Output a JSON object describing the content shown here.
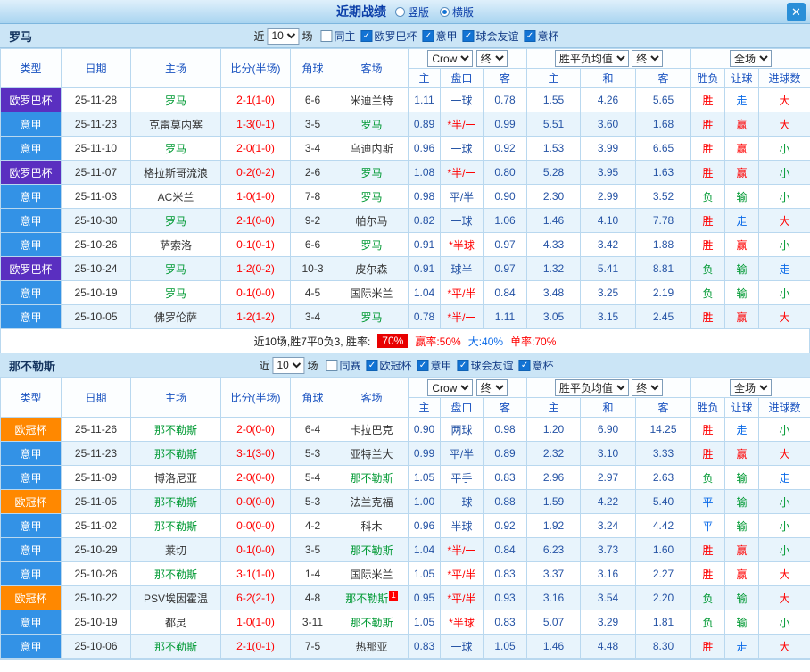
{
  "titlebar": {
    "title": "近期战绩",
    "layout_options": [
      {
        "label": "竖版",
        "selected": false
      },
      {
        "label": "横版",
        "selected": true
      }
    ],
    "close_icon": "✕"
  },
  "league_colors": {
    "意甲": "#3392e6",
    "欧罗巴杯": "#5a2fc0",
    "欧冠杯": "#ff8800"
  },
  "table_header": {
    "main": [
      "类型",
      "日期",
      "主场",
      "比分(半场)",
      "角球",
      "客场"
    ],
    "odds_select": "Crow",
    "odds_final": "终",
    "avg_select": "胜平负均值",
    "avg_final": "终",
    "full_select": "全场",
    "odds_sub": [
      "主",
      "盘口",
      "客"
    ],
    "avg_sub": [
      "主",
      "和",
      "客"
    ],
    "full_sub": [
      "胜负",
      "让球",
      "进球数"
    ]
  },
  "sections": [
    {
      "team": "罗马",
      "filter": {
        "near_label": "近",
        "count": "10",
        "games_label": "场",
        "checkboxes": [
          {
            "label": "同主",
            "checked": false
          },
          {
            "label": "欧罗巴杯",
            "checked": true
          },
          {
            "label": "意甲",
            "checked": true
          },
          {
            "label": "球会友谊",
            "checked": true
          },
          {
            "label": "意杯",
            "checked": true
          }
        ]
      },
      "rows": [
        {
          "league": "欧罗巴杯",
          "date": "25-11-28",
          "home": "罗马",
          "home_focus": true,
          "score": "2-1(1-0)",
          "corners": "6-6",
          "away": "米迪兰特",
          "away_focus": false,
          "away_badge": "",
          "odds": [
            "1.11",
            "一球",
            "0.78"
          ],
          "handicap_red": false,
          "avg": [
            "1.55",
            "4.26",
            "5.65"
          ],
          "result": {
            "text": "胜",
            "color": "red"
          },
          "asian": {
            "text": "走",
            "color": "blue"
          },
          "goals": {
            "text": "大",
            "color": "red"
          }
        },
        {
          "league": "意甲",
          "date": "25-11-23",
          "home": "克雷莫内塞",
          "home_focus": false,
          "score": "1-3(0-1)",
          "corners": "3-5",
          "away": "罗马",
          "away_focus": true,
          "away_badge": "",
          "odds": [
            "0.89",
            "*半/一",
            "0.99"
          ],
          "handicap_red": true,
          "avg": [
            "5.51",
            "3.60",
            "1.68"
          ],
          "result": {
            "text": "胜",
            "color": "red"
          },
          "asian": {
            "text": "赢",
            "color": "red"
          },
          "goals": {
            "text": "大",
            "color": "red"
          }
        },
        {
          "league": "意甲",
          "date": "25-11-10",
          "home": "罗马",
          "home_focus": true,
          "score": "2-0(1-0)",
          "corners": "3-4",
          "away": "乌迪内斯",
          "away_focus": false,
          "away_badge": "",
          "odds": [
            "0.96",
            "一球",
            "0.92"
          ],
          "handicap_red": false,
          "avg": [
            "1.53",
            "3.99",
            "6.65"
          ],
          "result": {
            "text": "胜",
            "color": "red"
          },
          "asian": {
            "text": "赢",
            "color": "red"
          },
          "goals": {
            "text": "小",
            "color": "green"
          }
        },
        {
          "league": "欧罗巴杯",
          "date": "25-11-07",
          "home": "格拉斯哥流浪",
          "home_focus": false,
          "score": "0-2(0-2)",
          "corners": "2-6",
          "away": "罗马",
          "away_focus": true,
          "away_badge": "",
          "odds": [
            "1.08",
            "*半/一",
            "0.80"
          ],
          "handicap_red": true,
          "avg": [
            "5.28",
            "3.95",
            "1.63"
          ],
          "result": {
            "text": "胜",
            "color": "red"
          },
          "asian": {
            "text": "赢",
            "color": "red"
          },
          "goals": {
            "text": "小",
            "color": "green"
          }
        },
        {
          "league": "意甲",
          "date": "25-11-03",
          "home": "AC米兰",
          "home_focus": false,
          "score": "1-0(1-0)",
          "corners": "7-8",
          "away": "罗马",
          "away_focus": true,
          "away_badge": "",
          "odds": [
            "0.98",
            "平/半",
            "0.90"
          ],
          "handicap_red": false,
          "avg": [
            "2.30",
            "2.99",
            "3.52"
          ],
          "result": {
            "text": "负",
            "color": "green"
          },
          "asian": {
            "text": "输",
            "color": "green"
          },
          "goals": {
            "text": "小",
            "color": "green"
          }
        },
        {
          "league": "意甲",
          "date": "25-10-30",
          "home": "罗马",
          "home_focus": true,
          "score": "2-1(0-0)",
          "corners": "9-2",
          "away": "帕尔马",
          "away_focus": false,
          "away_badge": "",
          "odds": [
            "0.82",
            "一球",
            "1.06"
          ],
          "handicap_red": false,
          "avg": [
            "1.46",
            "4.10",
            "7.78"
          ],
          "result": {
            "text": "胜",
            "color": "red"
          },
          "asian": {
            "text": "走",
            "color": "blue"
          },
          "goals": {
            "text": "大",
            "color": "red"
          }
        },
        {
          "league": "意甲",
          "date": "25-10-26",
          "home": "萨索洛",
          "home_focus": false,
          "score": "0-1(0-1)",
          "corners": "6-6",
          "away": "罗马",
          "away_focus": true,
          "away_badge": "",
          "odds": [
            "0.91",
            "*半球",
            "0.97"
          ],
          "handicap_red": true,
          "avg": [
            "4.33",
            "3.42",
            "1.88"
          ],
          "result": {
            "text": "胜",
            "color": "red"
          },
          "asian": {
            "text": "赢",
            "color": "red"
          },
          "goals": {
            "text": "小",
            "color": "green"
          }
        },
        {
          "league": "欧罗巴杯",
          "date": "25-10-24",
          "home": "罗马",
          "home_focus": true,
          "score": "1-2(0-2)",
          "corners": "10-3",
          "away": "皮尔森",
          "away_focus": false,
          "away_badge": "",
          "odds": [
            "0.91",
            "球半",
            "0.97"
          ],
          "handicap_red": false,
          "avg": [
            "1.32",
            "5.41",
            "8.81"
          ],
          "result": {
            "text": "负",
            "color": "green"
          },
          "asian": {
            "text": "输",
            "color": "green"
          },
          "goals": {
            "text": "走",
            "color": "blue"
          }
        },
        {
          "league": "意甲",
          "date": "25-10-19",
          "home": "罗马",
          "home_focus": true,
          "score": "0-1(0-0)",
          "corners": "4-5",
          "away": "国际米兰",
          "away_focus": false,
          "away_badge": "",
          "odds": [
            "1.04",
            "*平/半",
            "0.84"
          ],
          "handicap_red": true,
          "avg": [
            "3.48",
            "3.25",
            "2.19"
          ],
          "result": {
            "text": "负",
            "color": "green"
          },
          "asian": {
            "text": "输",
            "color": "green"
          },
          "goals": {
            "text": "小",
            "color": "green"
          }
        },
        {
          "league": "意甲",
          "date": "25-10-05",
          "home": "佛罗伦萨",
          "home_focus": false,
          "score": "1-2(1-2)",
          "corners": "3-4",
          "away": "罗马",
          "away_focus": true,
          "away_badge": "",
          "odds": [
            "0.78",
            "*半/一",
            "1.11"
          ],
          "handicap_red": true,
          "avg": [
            "3.05",
            "3.15",
            "2.45"
          ],
          "result": {
            "text": "胜",
            "color": "red"
          },
          "asian": {
            "text": "赢",
            "color": "red"
          },
          "goals": {
            "text": "大",
            "color": "red"
          }
        }
      ],
      "summary": {
        "prefix": "近10场,胜7平0负3, 胜率:",
        "win_rate": "70%",
        "parts": [
          {
            "text": "赢率:50%",
            "color": "red"
          },
          {
            "text": "大:40%",
            "color": "blue"
          },
          {
            "text": "单率:70%",
            "color": "red"
          }
        ]
      }
    },
    {
      "team": "那不勒斯",
      "filter": {
        "near_label": "近",
        "count": "10",
        "games_label": "场",
        "checkboxes": [
          {
            "label": "同赛",
            "checked": false
          },
          {
            "label": "欧冠杯",
            "checked": true
          },
          {
            "label": "意甲",
            "checked": true
          },
          {
            "label": "球会友谊",
            "checked": true
          },
          {
            "label": "意杯",
            "checked": true
          }
        ]
      },
      "rows": [
        {
          "league": "欧冠杯",
          "date": "25-11-26",
          "home": "那不勒斯",
          "home_focus": true,
          "score": "2-0(0-0)",
          "corners": "6-4",
          "away": "卡拉巴克",
          "away_focus": false,
          "away_badge": "",
          "odds": [
            "0.90",
            "两球",
            "0.98"
          ],
          "handicap_red": false,
          "avg": [
            "1.20",
            "6.90",
            "14.25"
          ],
          "result": {
            "text": "胜",
            "color": "red"
          },
          "asian": {
            "text": "走",
            "color": "blue"
          },
          "goals": {
            "text": "小",
            "color": "green"
          }
        },
        {
          "league": "意甲",
          "date": "25-11-23",
          "home": "那不勒斯",
          "home_focus": true,
          "score": "3-1(3-0)",
          "corners": "5-3",
          "away": "亚特兰大",
          "away_focus": false,
          "away_badge": "",
          "odds": [
            "0.99",
            "平/半",
            "0.89"
          ],
          "handicap_red": false,
          "avg": [
            "2.32",
            "3.10",
            "3.33"
          ],
          "result": {
            "text": "胜",
            "color": "red"
          },
          "asian": {
            "text": "赢",
            "color": "red"
          },
          "goals": {
            "text": "大",
            "color": "red"
          }
        },
        {
          "league": "意甲",
          "date": "25-11-09",
          "home": "博洛尼亚",
          "home_focus": false,
          "score": "2-0(0-0)",
          "corners": "5-4",
          "away": "那不勒斯",
          "away_focus": true,
          "away_badge": "",
          "odds": [
            "1.05",
            "平手",
            "0.83"
          ],
          "handicap_red": false,
          "avg": [
            "2.96",
            "2.97",
            "2.63"
          ],
          "result": {
            "text": "负",
            "color": "green"
          },
          "asian": {
            "text": "输",
            "color": "green"
          },
          "goals": {
            "text": "走",
            "color": "blue"
          }
        },
        {
          "league": "欧冠杯",
          "date": "25-11-05",
          "home": "那不勒斯",
          "home_focus": true,
          "score": "0-0(0-0)",
          "corners": "5-3",
          "away": "法兰克福",
          "away_focus": false,
          "away_badge": "",
          "odds": [
            "1.00",
            "一球",
            "0.88"
          ],
          "handicap_red": false,
          "avg": [
            "1.59",
            "4.22",
            "5.40"
          ],
          "result": {
            "text": "平",
            "color": "blue"
          },
          "asian": {
            "text": "输",
            "color": "green"
          },
          "goals": {
            "text": "小",
            "color": "green"
          }
        },
        {
          "league": "意甲",
          "date": "25-11-02",
          "home": "那不勒斯",
          "home_focus": true,
          "score": "0-0(0-0)",
          "corners": "4-2",
          "away": "科木",
          "away_focus": false,
          "away_badge": "",
          "odds": [
            "0.96",
            "半球",
            "0.92"
          ],
          "handicap_red": false,
          "avg": [
            "1.92",
            "3.24",
            "4.42"
          ],
          "result": {
            "text": "平",
            "color": "blue"
          },
          "asian": {
            "text": "输",
            "color": "green"
          },
          "goals": {
            "text": "小",
            "color": "green"
          }
        },
        {
          "league": "意甲",
          "date": "25-10-29",
          "home": "莱切",
          "home_focus": false,
          "score": "0-1(0-0)",
          "corners": "3-5",
          "away": "那不勒斯",
          "away_focus": true,
          "away_badge": "",
          "odds": [
            "1.04",
            "*半/一",
            "0.84"
          ],
          "handicap_red": true,
          "avg": [
            "6.23",
            "3.73",
            "1.60"
          ],
          "result": {
            "text": "胜",
            "color": "red"
          },
          "asian": {
            "text": "赢",
            "color": "red"
          },
          "goals": {
            "text": "小",
            "color": "green"
          }
        },
        {
          "league": "意甲",
          "date": "25-10-26",
          "home": "那不勒斯",
          "home_focus": true,
          "score": "3-1(1-0)",
          "corners": "1-4",
          "away": "国际米兰",
          "away_focus": false,
          "away_badge": "",
          "odds": [
            "1.05",
            "*平/半",
            "0.83"
          ],
          "handicap_red": true,
          "avg": [
            "3.37",
            "3.16",
            "2.27"
          ],
          "result": {
            "text": "胜",
            "color": "red"
          },
          "asian": {
            "text": "赢",
            "color": "red"
          },
          "goals": {
            "text": "大",
            "color": "red"
          }
        },
        {
          "league": "欧冠杯",
          "date": "25-10-22",
          "home": "PSV埃因霍温",
          "home_focus": false,
          "score": "6-2(2-1)",
          "corners": "4-8",
          "away": "那不勒斯",
          "away_focus": true,
          "away_badge": "1",
          "odds": [
            "0.95",
            "*平/半",
            "0.93"
          ],
          "handicap_red": true,
          "avg": [
            "3.16",
            "3.54",
            "2.20"
          ],
          "result": {
            "text": "负",
            "color": "green"
          },
          "asian": {
            "text": "输",
            "color": "green"
          },
          "goals": {
            "text": "大",
            "color": "red"
          }
        },
        {
          "league": "意甲",
          "date": "25-10-19",
          "home": "都灵",
          "home_focus": false,
          "score": "1-0(1-0)",
          "corners": "3-11",
          "away": "那不勒斯",
          "away_focus": true,
          "away_badge": "",
          "odds": [
            "1.05",
            "*半球",
            "0.83"
          ],
          "handicap_red": true,
          "avg": [
            "5.07",
            "3.29",
            "1.81"
          ],
          "result": {
            "text": "负",
            "color": "green"
          },
          "asian": {
            "text": "输",
            "color": "green"
          },
          "goals": {
            "text": "小",
            "color": "green"
          }
        },
        {
          "league": "意甲",
          "date": "25-10-06",
          "home": "那不勒斯",
          "home_focus": true,
          "score": "2-1(0-1)",
          "corners": "7-5",
          "away": "热那亚",
          "away_focus": false,
          "away_badge": "",
          "odds": [
            "0.83",
            "一球",
            "1.05"
          ],
          "handicap_red": false,
          "avg": [
            "1.46",
            "4.48",
            "8.30"
          ],
          "result": {
            "text": "胜",
            "color": "red"
          },
          "asian": {
            "text": "走",
            "color": "blue"
          },
          "goals": {
            "text": "大",
            "color": "red"
          }
        }
      ],
      "summary": null
    }
  ]
}
